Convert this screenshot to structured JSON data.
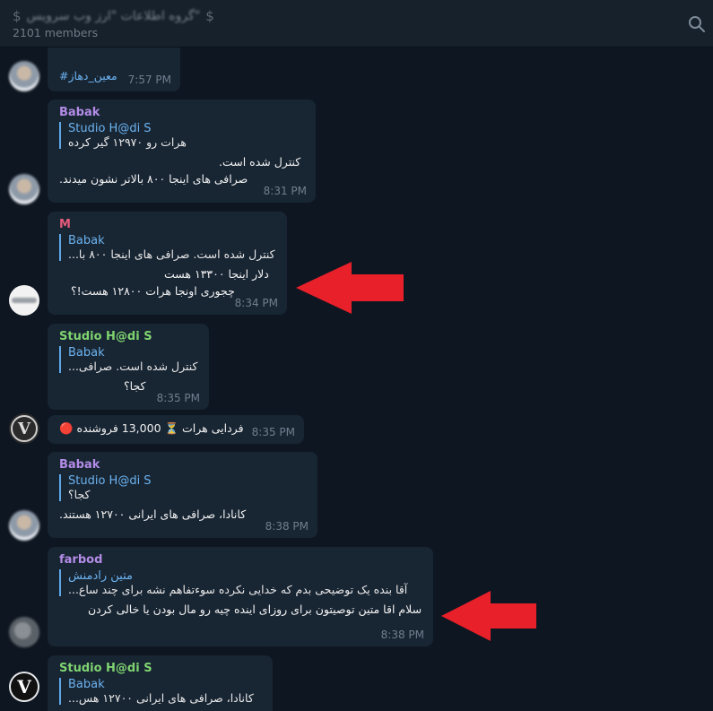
{
  "header": {
    "title": "گروه اطلاعات \"ارز وب سرویس\"",
    "member_count": "2101 members",
    "search_icon": "search-icon"
  },
  "messages": [
    {
      "id": "m0",
      "text": "#معین_دهاز",
      "time": "7:57 PM"
    },
    {
      "id": "m1",
      "sender": "Babak",
      "sender_color": "#b28ce6",
      "reply_name": "Studio H@di S",
      "reply_text": "هرات رو ۱۲۹۷۰ گیر کرده",
      "lines": [
        "کنترل شده است.",
        "صرافی های اینجا ۸۰۰ بالاتر نشون میدند."
      ],
      "time": "8:31 PM"
    },
    {
      "id": "m2",
      "sender": "M",
      "sender_color": "#e55b7a",
      "reply_name": "Babak",
      "reply_text": "کنترل شده است. صرافی های اینجا ۸۰۰ با...",
      "lines": [
        "دلار اینجا ۱۳۳۰۰ هست",
        "چجوری اونجا هرات ۱۲۸۰۰ هست!؟"
      ],
      "time": "8:34 PM"
    },
    {
      "id": "m3",
      "sender": "Studio H@di S",
      "sender_color": "#7fd470",
      "reply_name": "Babak",
      "reply_text": "کنترل شده است. صرافی...",
      "lines": [
        "کجا؟"
      ],
      "time": "8:35 PM"
    },
    {
      "id": "m4",
      "text": "فردایی  هرات ⏳ 13,000 فروشنده 🔴",
      "time": "8:35 PM"
    },
    {
      "id": "m5",
      "sender": "Babak",
      "sender_color": "#b28ce6",
      "reply_name": "Studio H@di S",
      "reply_text": "کجا؟",
      "lines": [
        "کانادا، صرافی های ایرانی ۱۲۷۰۰ هستند."
      ],
      "time": "8:38 PM"
    },
    {
      "id": "m6",
      "sender": "farbod",
      "sender_color": "#b28ce6",
      "reply_name": "متین رادمنش",
      "reply_text": "آقا بنده یک توضیحی بدم که خدایی نکرده سوءتفاهم نشه  برای چند ساع...",
      "lines": [
        "سلام اقا متین توصیتون برای روزای اینده  چیه رو مال بودن یا خالی کردن"
      ],
      "time": "8:38 PM"
    },
    {
      "id": "m7",
      "sender": "Studio H@di S",
      "sender_color": "#7fd470",
      "reply_name": "Babak",
      "reply_text": "کانادا، صرافی های ایرانی ۱۲۷۰۰ هس..."
    }
  ],
  "colors": {
    "background": "#0e1621",
    "bubble": "#182533",
    "arrow": "#e8202a",
    "link": "#6cb3f0"
  }
}
